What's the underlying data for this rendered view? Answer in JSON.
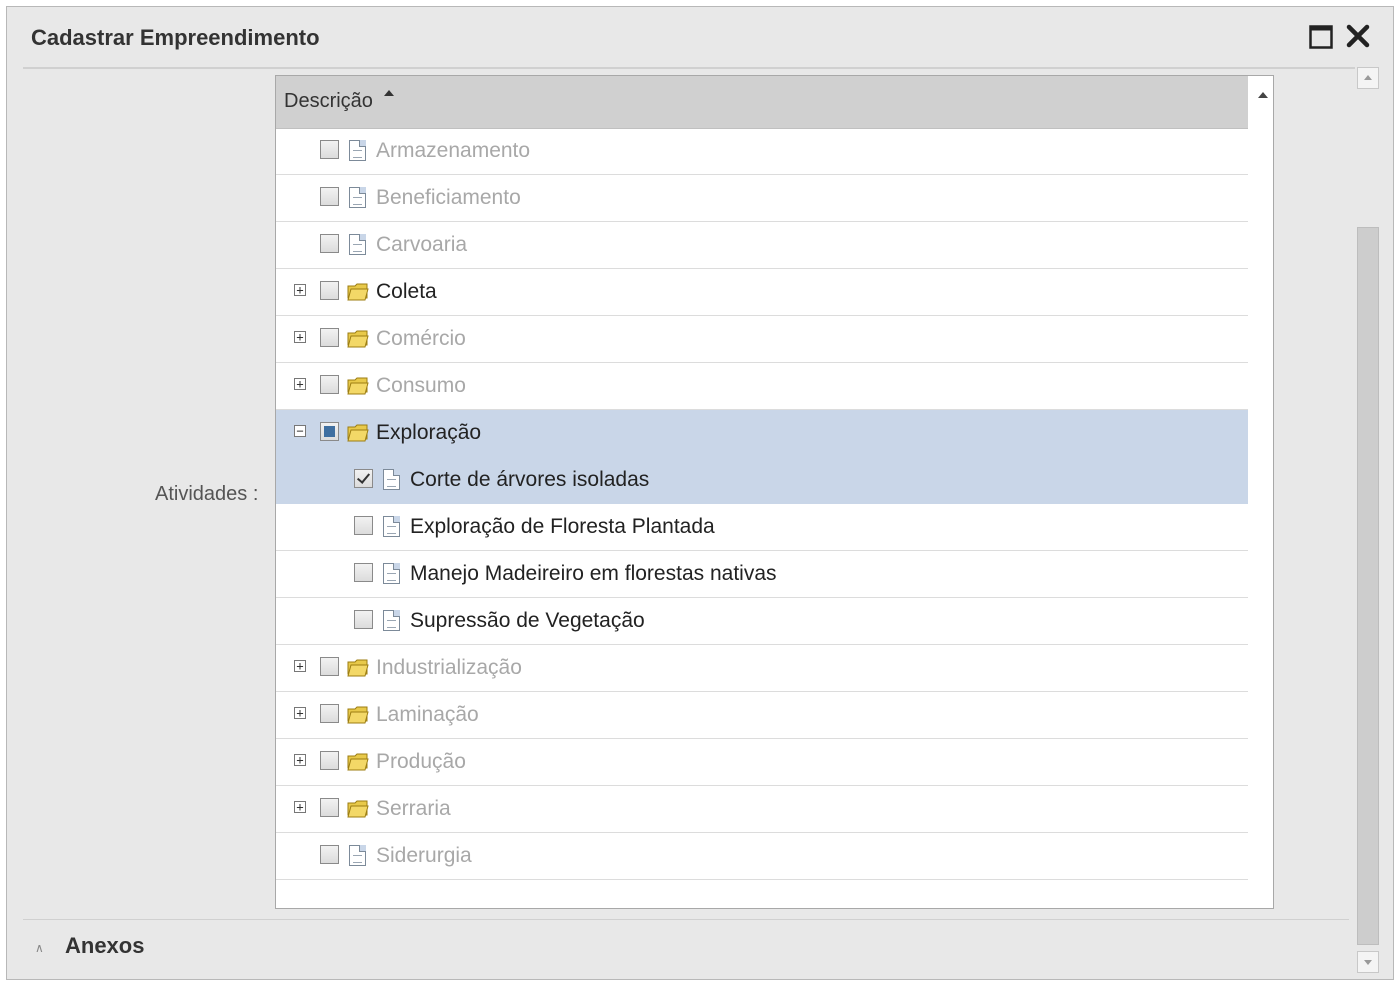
{
  "window": {
    "title": "Cadastrar Empreendimento"
  },
  "form": {
    "activities_label": "Atividades :"
  },
  "grid": {
    "column_header": "Descrição",
    "rows": [
      {
        "label": "Armazenamento",
        "type": "leaf",
        "level": 0,
        "expander": "",
        "checkbox": "unchecked",
        "muted": true,
        "selected": false
      },
      {
        "label": "Beneficiamento",
        "type": "leaf",
        "level": 0,
        "expander": "",
        "checkbox": "unchecked",
        "muted": true,
        "selected": false
      },
      {
        "label": "Carvoaria",
        "type": "leaf",
        "level": 0,
        "expander": "",
        "checkbox": "unchecked",
        "muted": true,
        "selected": false
      },
      {
        "label": "Coleta",
        "type": "folder",
        "level": 0,
        "expander": "+",
        "checkbox": "unchecked",
        "muted": false,
        "selected": false
      },
      {
        "label": "Comércio",
        "type": "folder",
        "level": 0,
        "expander": "+",
        "checkbox": "unchecked",
        "muted": true,
        "selected": false
      },
      {
        "label": "Consumo",
        "type": "folder",
        "level": 0,
        "expander": "+",
        "checkbox": "unchecked",
        "muted": true,
        "selected": false
      },
      {
        "label": "Exploração",
        "type": "folder",
        "level": 0,
        "expander": "−",
        "checkbox": "partial",
        "muted": false,
        "selected": true
      },
      {
        "label": "Corte de árvores isoladas",
        "type": "leaf",
        "level": 1,
        "expander": "",
        "checkbox": "checked",
        "muted": false,
        "selected": true
      },
      {
        "label": "Exploração de Floresta Plantada",
        "type": "leaf",
        "level": 1,
        "expander": "",
        "checkbox": "unchecked",
        "muted": false,
        "selected": false
      },
      {
        "label": "Manejo Madeireiro em florestas nativas",
        "type": "leaf",
        "level": 1,
        "expander": "",
        "checkbox": "unchecked",
        "muted": false,
        "selected": false
      },
      {
        "label": "Supressão de Vegetação",
        "type": "leaf",
        "level": 1,
        "expander": "",
        "checkbox": "unchecked",
        "muted": false,
        "selected": false
      },
      {
        "label": "Industrialização",
        "type": "folder",
        "level": 0,
        "expander": "+",
        "checkbox": "unchecked",
        "muted": true,
        "selected": false
      },
      {
        "label": "Laminação",
        "type": "folder",
        "level": 0,
        "expander": "+",
        "checkbox": "unchecked",
        "muted": true,
        "selected": false
      },
      {
        "label": "Produção",
        "type": "folder",
        "level": 0,
        "expander": "+",
        "checkbox": "unchecked",
        "muted": true,
        "selected": false
      },
      {
        "label": "Serraria",
        "type": "folder",
        "level": 0,
        "expander": "+",
        "checkbox": "unchecked",
        "muted": true,
        "selected": false
      },
      {
        "label": "Siderurgia",
        "type": "leaf",
        "level": 0,
        "expander": "",
        "checkbox": "unchecked",
        "muted": true,
        "selected": false
      }
    ]
  },
  "sections": {
    "attachments_label": "Anexos"
  },
  "colors": {
    "selected_row": "#c9d6e8",
    "muted_text": "#a8a8a8",
    "folder_yellow": "#e8c94a",
    "folder_outline": "#9c7d12"
  },
  "icons": {
    "maximize": "maximize-icon",
    "close": "close-icon",
    "sort": "sort-ascending-icon",
    "folder": "folder-icon",
    "document": "document-icon",
    "expand": "plus-square-icon",
    "collapse": "minus-square-icon",
    "caret": "caret-up-icon"
  }
}
